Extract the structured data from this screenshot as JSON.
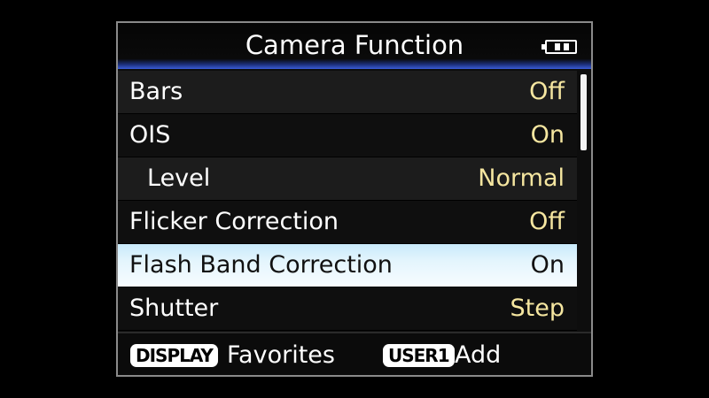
{
  "header": {
    "title": "Camera Function",
    "battery_icon": "battery-icon"
  },
  "menu": {
    "items": [
      {
        "label": "Bars",
        "value": "Off"
      },
      {
        "label": "OIS",
        "value": "On"
      },
      {
        "label": "Level",
        "value": "Normal"
      },
      {
        "label": "Flicker Correction",
        "value": "Off"
      },
      {
        "label": "Flash Band Correction",
        "value": "On"
      },
      {
        "label": "Shutter",
        "value": "Step"
      }
    ],
    "selected_index": 4
  },
  "footer": {
    "display_key": "DISPLAY",
    "display_action": "Favorites",
    "user1_key": "USER1",
    "user1_action": "Add"
  },
  "colors": {
    "value_text": "#f5e6a0",
    "selected_row": "#e4f5fd",
    "header_accent": "#3a5cd8"
  }
}
